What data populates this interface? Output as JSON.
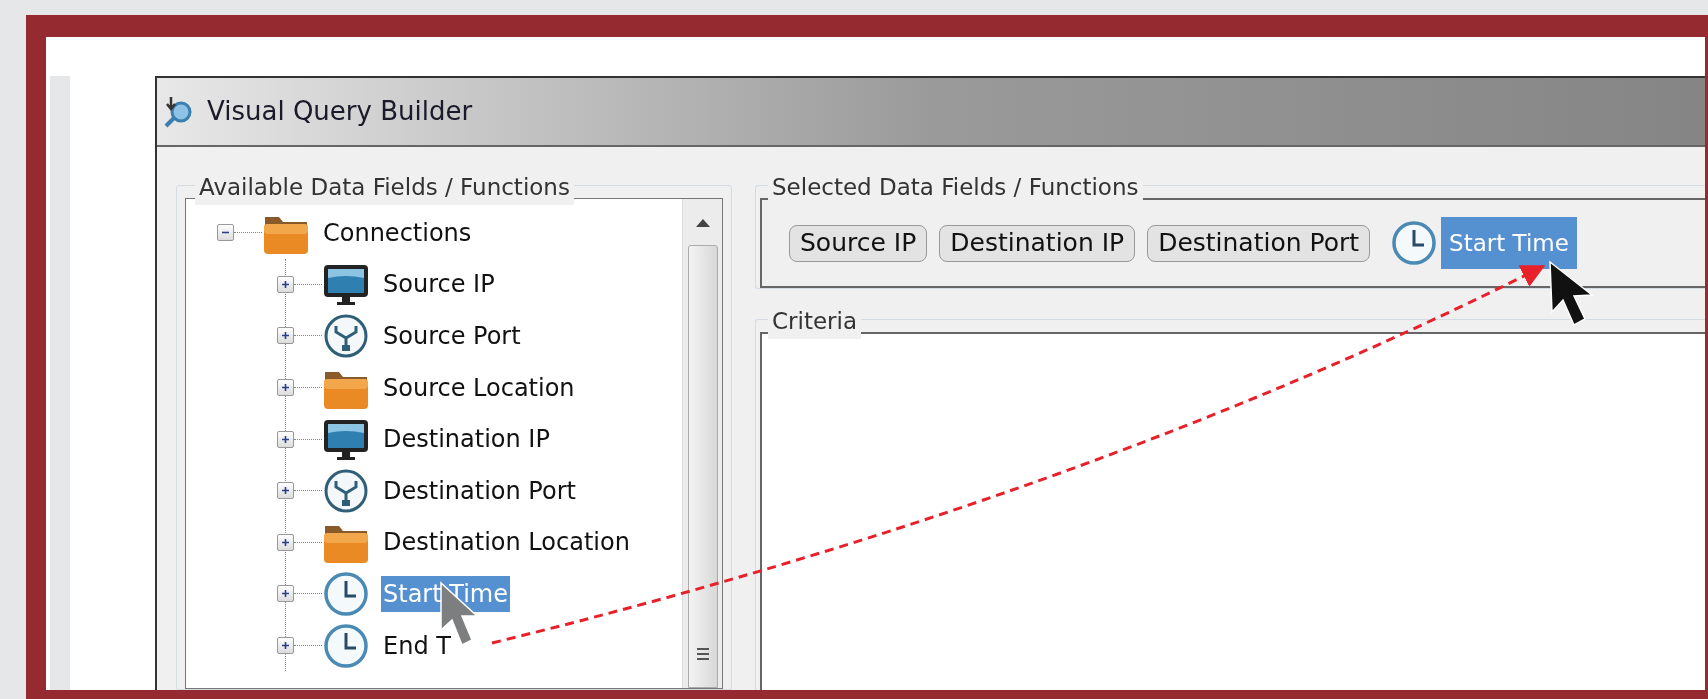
{
  "window": {
    "title": "Visual Query Builder"
  },
  "available_panel": {
    "title": "Available Data Fields / Functions",
    "tree": [
      {
        "label": "Connections",
        "kind": "folder",
        "expanded": true,
        "selected": false,
        "children": [
          {
            "label": "Source IP",
            "kind": "monitor",
            "expanded": false,
            "selected": false
          },
          {
            "label": "Source Port",
            "kind": "port",
            "expanded": false,
            "selected": false
          },
          {
            "label": "Source Location",
            "kind": "folder",
            "expanded": false,
            "selected": false
          },
          {
            "label": "Destination IP",
            "kind": "monitor",
            "expanded": false,
            "selected": false
          },
          {
            "label": "Destination Port",
            "kind": "port",
            "expanded": false,
            "selected": false
          },
          {
            "label": "Destination Location",
            "kind": "folder",
            "expanded": false,
            "selected": false
          },
          {
            "label": "Start Time",
            "kind": "clock",
            "expanded": false,
            "selected": true
          },
          {
            "label": "End T",
            "kind": "clock",
            "expanded": false,
            "selected": false
          }
        ]
      }
    ]
  },
  "selected_panel": {
    "title": "Selected Data Fields / Functions",
    "chips": [
      {
        "label": "Source IP",
        "kind": "chip"
      },
      {
        "label": "Destination IP",
        "kind": "chip"
      },
      {
        "label": "Destination Port",
        "kind": "chip"
      },
      {
        "label": "Start Time",
        "kind": "dragged"
      }
    ]
  },
  "criteria_panel": {
    "title": "Criteria"
  }
}
